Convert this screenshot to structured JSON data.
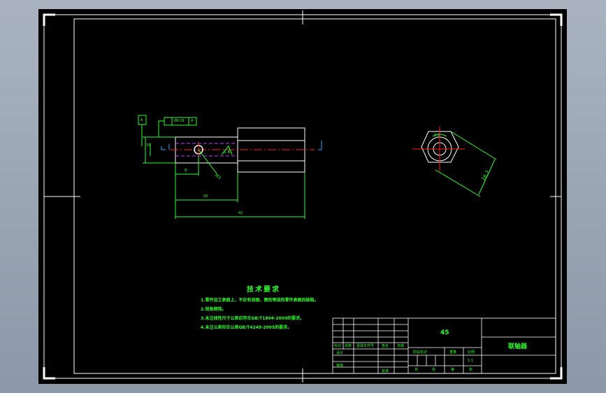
{
  "drawing": {
    "dims": {
      "d_8": "8",
      "d_20": "20",
      "d_42": "42",
      "angle_left": "18",
      "hex_flats": "16.2",
      "ring_label": "0.1",
      "tol": "Ø0.01",
      "datum": "A",
      "leader_small": "A"
    },
    "notes": {
      "title": "技术要求",
      "items": [
        "1.零件加工表面上，不应有划痕、擦伤等损伤零件表面的缺陷。",
        "2.锐角倒钝。",
        "3.未注线性尺寸公差应符合GB/T1804-2000的要求。",
        "4.未注公差形位公差GB/T4249-2005的要求。"
      ]
    },
    "title_block": {
      "material": "45",
      "part_name": "联轴器",
      "scale": "1:1",
      "row_labels": [
        "标记",
        "处数",
        "更改文件号",
        "签名",
        "日期"
      ],
      "design_label": "设计",
      "check_label": "审核",
      "approve_label": "批准",
      "stage_label": "阶段标记",
      "weight_label": "重量",
      "ratio_label": "比例",
      "sheet_label": "共",
      "page_label": "第",
      "sheet_suffix": "张"
    }
  },
  "colors": {
    "line": "#ffffff",
    "dim": "#2bff2b",
    "center": "#ff2020",
    "hidden": "#c040ff",
    "datum": "#3aa0ff"
  }
}
